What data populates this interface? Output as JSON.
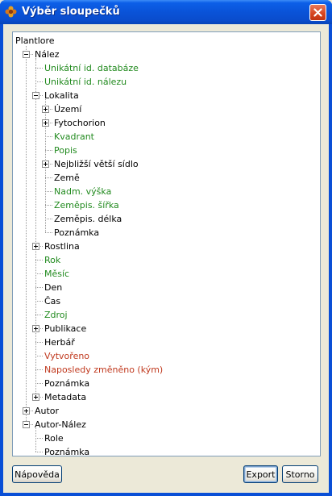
{
  "window": {
    "title": "Výběr sloupečků"
  },
  "buttons": {
    "help": "Nápověda",
    "export": "Export",
    "cancel": "Storno"
  },
  "tree": [
    {
      "label": "Plantlore",
      "depth": 0,
      "color": "black",
      "exp": null
    },
    {
      "label": "Nález",
      "depth": 1,
      "color": "black",
      "exp": "minus"
    },
    {
      "label": "Unikátní id. databáze",
      "depth": 2,
      "color": "green",
      "exp": null
    },
    {
      "label": "Unikátní id. nálezu",
      "depth": 2,
      "color": "green",
      "exp": null
    },
    {
      "label": "Lokalita",
      "depth": 2,
      "color": "black",
      "exp": "minus"
    },
    {
      "label": "Území",
      "depth": 3,
      "color": "black",
      "exp": "plus"
    },
    {
      "label": "Fytochorion",
      "depth": 3,
      "color": "black",
      "exp": "plus"
    },
    {
      "label": "Kvadrant",
      "depth": 3,
      "color": "green",
      "exp": null
    },
    {
      "label": "Popis",
      "depth": 3,
      "color": "green",
      "exp": null
    },
    {
      "label": "Nejbližší větší sídlo",
      "depth": 3,
      "color": "black",
      "exp": "plus"
    },
    {
      "label": "Země",
      "depth": 3,
      "color": "black",
      "exp": null
    },
    {
      "label": "Nadm. výška",
      "depth": 3,
      "color": "green",
      "exp": null
    },
    {
      "label": "Zeměpis. šířka",
      "depth": 3,
      "color": "green",
      "exp": null
    },
    {
      "label": "Zeměpis. délka",
      "depth": 3,
      "color": "black",
      "exp": null
    },
    {
      "label": "Poznámka",
      "depth": 3,
      "color": "black",
      "exp": null
    },
    {
      "label": "Rostlina",
      "depth": 2,
      "color": "black",
      "exp": "plus"
    },
    {
      "label": "Rok",
      "depth": 2,
      "color": "green",
      "exp": null
    },
    {
      "label": "Měsíc",
      "depth": 2,
      "color": "green",
      "exp": null
    },
    {
      "label": "Den",
      "depth": 2,
      "color": "black",
      "exp": null
    },
    {
      "label": "Čas",
      "depth": 2,
      "color": "black",
      "exp": null
    },
    {
      "label": "Zdroj",
      "depth": 2,
      "color": "green",
      "exp": null
    },
    {
      "label": "Publikace",
      "depth": 2,
      "color": "black",
      "exp": "plus"
    },
    {
      "label": "Herbář",
      "depth": 2,
      "color": "black",
      "exp": null
    },
    {
      "label": "Vytvořeno",
      "depth": 2,
      "color": "red",
      "exp": null
    },
    {
      "label": "Naposledy změněno (kým)",
      "depth": 2,
      "color": "red",
      "exp": null
    },
    {
      "label": "Poznámka",
      "depth": 2,
      "color": "black",
      "exp": null
    },
    {
      "label": "Metadata",
      "depth": 2,
      "color": "black",
      "exp": "plus"
    },
    {
      "label": "Autor",
      "depth": 1,
      "color": "black",
      "exp": "plus"
    },
    {
      "label": "Autor-Nález",
      "depth": 1,
      "color": "black",
      "exp": "minus"
    },
    {
      "label": "Role",
      "depth": 2,
      "color": "black",
      "exp": null
    },
    {
      "label": "Poznámka",
      "depth": 2,
      "color": "black",
      "exp": null
    }
  ]
}
